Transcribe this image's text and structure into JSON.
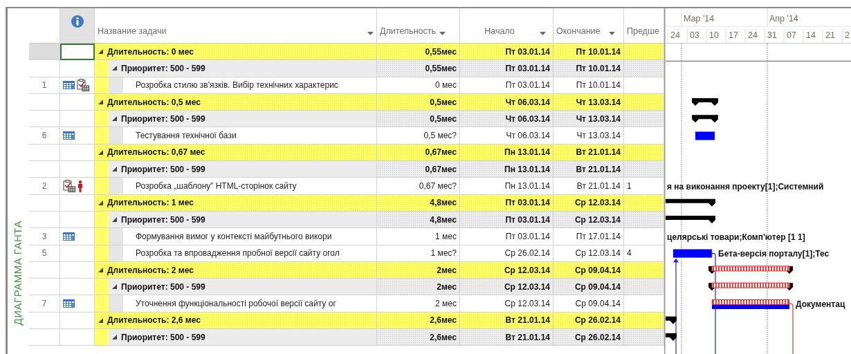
{
  "view_bar": {
    "label": "ДИАГРАММА ГАНТА"
  },
  "columns": [
    {
      "label": "Название задачи",
      "menu": true
    },
    {
      "label": "Длительность",
      "menu": true
    },
    {
      "label": "Начало",
      "menu": true
    },
    {
      "label": "Окончание",
      "menu": true
    },
    {
      "label": "Предше",
      "menu": false
    }
  ],
  "timescale": {
    "months": [
      {
        "label": "Мар '14"
      },
      {
        "label": "Апр '14"
      }
    ],
    "weeks": [
      "24",
      "03",
      "10",
      "17",
      "24",
      "31",
      "07",
      "14",
      "21",
      "2"
    ]
  },
  "rows": [
    {
      "kind": "group1",
      "selected": true,
      "expanded": true,
      "name": "Длительность: 0 мес",
      "duration": "0,55мес",
      "start": "Пт 03.01.14",
      "finish": "Пт 10.01.14"
    },
    {
      "kind": "group2",
      "selected": false,
      "expanded": true,
      "name": "Приоритет: 500 - 599",
      "duration": "0,55мес",
      "start": "Пт 03.01.14",
      "finish": "Пт 10.01.14"
    },
    {
      "kind": "task",
      "selected": false,
      "id": "1",
      "indicators": [
        {
          "kind": "calendar"
        },
        {
          "kind": "notes"
        }
      ],
      "name": "Розробка стилю зв'язків. Вибір технічних характерис",
      "duration": "0 мес",
      "start": "Пт 03.01.14",
      "finish": "Пт 10.01.14"
    },
    {
      "kind": "group1",
      "selected": false,
      "expanded": true,
      "name": "Длительность: 0,5 мес",
      "duration": "0,5мес",
      "start": "Чт 06.03.14",
      "finish": "Чт 13.03.14",
      "bar": {
        "kind": "summary"
      }
    },
    {
      "kind": "group2",
      "selected": false,
      "expanded": true,
      "name": "Приоритет: 500 - 599",
      "duration": "0,5мес",
      "start": "Чт 06.03.14",
      "finish": "Чт 13.03.14",
      "bar": {
        "kind": "summary"
      }
    },
    {
      "kind": "task",
      "selected": false,
      "id": "6",
      "indicators": [
        {
          "kind": "calendar"
        }
      ],
      "name": "Тестування  технічної бази",
      "duration": "0,5 мес?",
      "start": "Чт 06.03.14",
      "finish": "Чт 13.03.14",
      "bar": {
        "kind": "task"
      }
    },
    {
      "kind": "group1",
      "selected": false,
      "expanded": true,
      "name": "Длительность: 0,67 мес",
      "duration": "0,67мес",
      "start": "Пн 13.01.14",
      "finish": "Вт 21.01.14"
    },
    {
      "kind": "group2",
      "selected": false,
      "expanded": true,
      "name": "Приоритет: 500 - 599",
      "duration": "0,67мес",
      "start": "Пн 13.01.14",
      "finish": "Вт 21.01.14"
    },
    {
      "kind": "task",
      "selected": false,
      "id": "2",
      "indicators": [
        {
          "kind": "notes"
        },
        {
          "kind": "resource"
        }
      ],
      "name": "Розробка  „шаблону” HTML-сторінок сайту",
      "duration": "0,67 мес?",
      "start": "Пн 13.01.14",
      "finish": "Вт 21.01.14",
      "predecessors": "1",
      "bar_label": "я на виконання проекту[1];Системний"
    },
    {
      "kind": "group1",
      "selected": false,
      "expanded": true,
      "name": "Длительность: 1 мес",
      "duration": "4,8мес",
      "start": "Пт 03.01.14",
      "finish": "Ср 12.03.14",
      "bar": {
        "kind": "summary"
      }
    },
    {
      "kind": "group2",
      "selected": false,
      "expanded": true,
      "name": "Приоритет: 500 - 599",
      "duration": "4,8мес",
      "start": "Пт 03.01.14",
      "finish": "Ср 12.03.14",
      "bar": {
        "kind": "summary"
      }
    },
    {
      "kind": "task",
      "selected": false,
      "id": "3",
      "indicators": [
        {
          "kind": "calendar"
        }
      ],
      "name": "Формування вимог у контексті майбутнього викори",
      "duration": "1 мес",
      "start": "Пт 03.01.14",
      "finish": "Пт 17.01.14",
      "bar_label": "целярські товари;Комп'ютер [1 1]"
    },
    {
      "kind": "task",
      "selected": false,
      "id": "5",
      "indicators": [],
      "name": "Розробка та впровадження пробної версії сайту огол",
      "duration": "1 мес?",
      "start": "Ср 26.02.14",
      "finish": "Ср 12.03.14",
      "predecessors": "4",
      "bar": {
        "kind": "task"
      },
      "bar_label": "Бета-версія порталу[1];Тес",
      "links": [
        {
          "kind": "in_from_below"
        },
        {
          "kind": "out_down"
        }
      ]
    },
    {
      "kind": "group1",
      "selected": false,
      "expanded": true,
      "name": "Длительность: 2 мес",
      "duration": "2мес",
      "start": "Ср 12.03.14",
      "finish": "Ср 09.04.14",
      "bar": {
        "kind": "critical_summary"
      }
    },
    {
      "kind": "group2",
      "selected": false,
      "expanded": true,
      "name": "Приоритет: 500 - 599",
      "duration": "2мес",
      "start": "Ср 12.03.14",
      "finish": "Ср 09.04.14",
      "bar": {
        "kind": "critical_summary"
      }
    },
    {
      "kind": "task",
      "selected": false,
      "id": "7",
      "indicators": [
        {
          "kind": "calendar"
        }
      ],
      "name": "Уточнення функціональності робочої версії сайту ог",
      "duration": "2 мес",
      "start": "Ср 12.03.14",
      "finish": "Ср 09.04.14",
      "bar": {
        "kind": "critical_task"
      },
      "bar_label": "Документац",
      "links": [
        {
          "kind": "out_down"
        }
      ]
    },
    {
      "kind": "group1",
      "selected": false,
      "expanded": true,
      "name": "Длительность: 2,6 мес",
      "duration": "2,6мес",
      "start": "Вт 21.01.14",
      "finish": "Ср 26.02.14",
      "bar": {
        "kind": "summary"
      }
    },
    {
      "kind": "group2",
      "selected": false,
      "expanded": true,
      "name": "Приоритет: 500 - 599",
      "duration": "2,6мес",
      "start": "Вт 21.01.14",
      "finish": "Ср 26.02.14",
      "bar": {
        "kind": "summary"
      }
    }
  ]
}
